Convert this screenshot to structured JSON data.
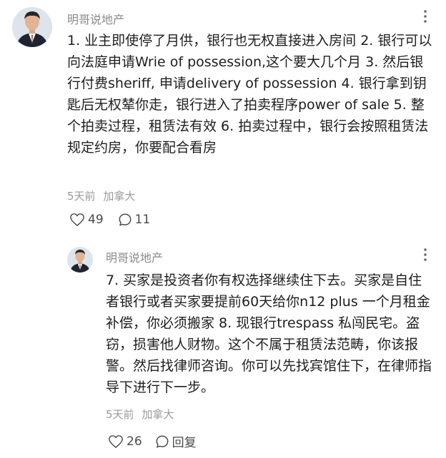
{
  "comments": [
    {
      "author": "明哥说地产",
      "text": "1. 业主即使停了月供，银行也无权直接进入房间 2. 银行可以向法庭申请Wrie of possession,这个要大几个月 3. 然后银行付费sheriff, 申请delivery of possession 4. 银行拿到钥匙后无权辇你走，银行进入了拍卖程序power of sale 5. 整个拍卖过程，租赁法有效 6. 拍卖过程中，银行会按照租赁法规定约房，你要配合看房",
      "time": "5天前",
      "location": "加拿大",
      "likes": "49",
      "replies": "11"
    },
    {
      "author": "明哥说地产",
      "text": "7. 买家是投资者你有权选择继续住下去。买家是自住者银行或者买家要提前60天给你n12 plus 一个月租金补偿，你必须搬家 8. 现银行trespass 私闯民宅。盗窃，损害他人财物。这个不属于租赁法范畴，你该报警。然后找律师咨询。你可以先找宾馆住下，在律师指导下进行下一步。",
      "time": "5天前",
      "location": "加拿大",
      "likes": "26",
      "reply_label": "回复"
    }
  ],
  "icons": {
    "more": "more-vertical-icon",
    "like": "heart-icon",
    "reply": "comment-bubble-icon"
  }
}
